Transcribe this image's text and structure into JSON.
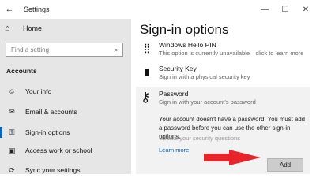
{
  "window": {
    "title": "Settings",
    "back_glyph": "←",
    "minimize_glyph": "—",
    "maximize_glyph": "☐",
    "close_glyph": "✕"
  },
  "sidebar": {
    "home_label": "Home",
    "search_placeholder": "Find a setting",
    "section_title": "Accounts",
    "items": [
      {
        "label": "Your info",
        "icon": "person-card-icon",
        "glyph": "☺"
      },
      {
        "label": "Email & accounts",
        "icon": "mail-icon",
        "glyph": "✉"
      },
      {
        "label": "Sign-in options",
        "icon": "key-icon",
        "glyph": "⚿"
      },
      {
        "label": "Access work or school",
        "icon": "briefcase-icon",
        "glyph": "▣"
      },
      {
        "label": "Sync your settings",
        "icon": "sync-icon",
        "glyph": "⟳"
      }
    ],
    "active_index": 2
  },
  "main": {
    "title": "Sign-in options",
    "options": [
      {
        "name": "Windows Hello PIN",
        "desc": "This option is currently unavailable—click to learn more",
        "icon": "keypad-icon",
        "glyph": "⣿"
      },
      {
        "name": "Security Key",
        "desc": "Sign in with a physical security key",
        "icon": "usb-key-icon",
        "glyph": "▮"
      }
    ],
    "password": {
      "name": "Password",
      "desc": "Sign in with your account's password",
      "message": "Your account doesn't have a password. You must add a password before you can use the other sign-in options.",
      "security_questions": "Update your security questions",
      "learn_more": "Learn more",
      "add_label": "Add",
      "icon": "key-icon",
      "glyph": "⚷"
    }
  },
  "colors": {
    "accent": "#0067c0",
    "arrow": "#e8232a",
    "sidebar_bg": "#e6e6e6",
    "panel_bg": "#f2f2f2"
  }
}
